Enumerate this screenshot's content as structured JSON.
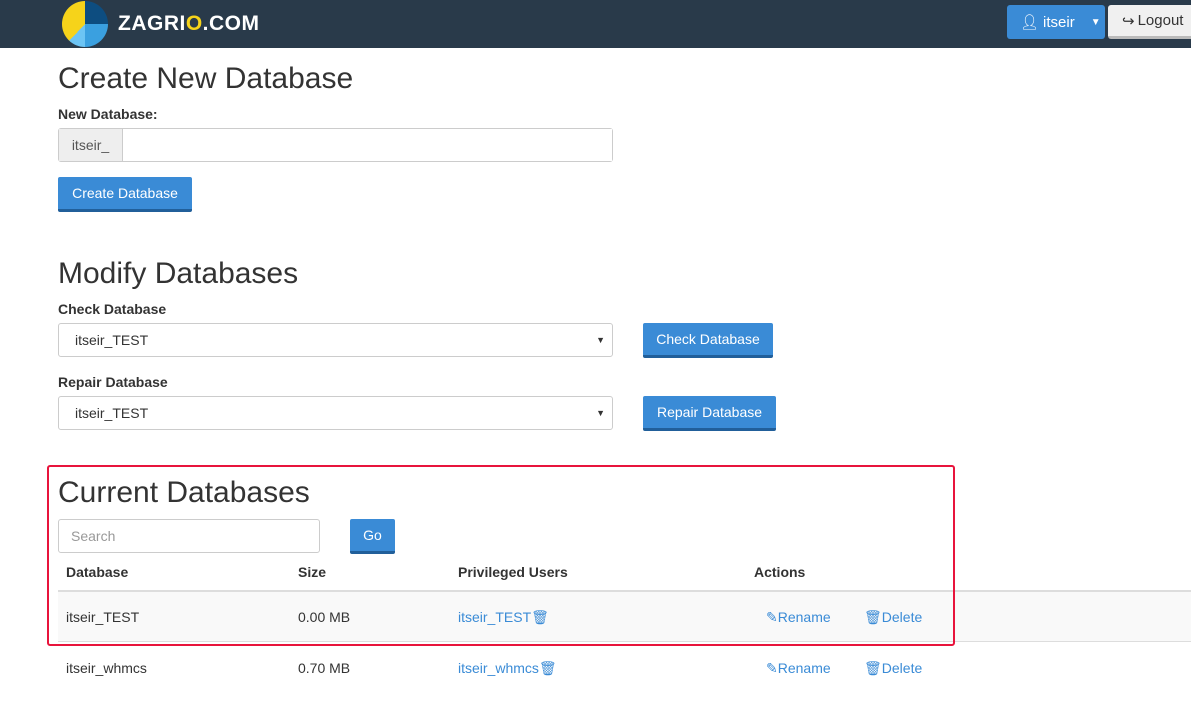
{
  "header": {
    "logo_text_a": "ZAGRI",
    "logo_text_o": "O",
    "logo_text_b": ".COM",
    "user": "itseir",
    "logout": "Logout"
  },
  "create": {
    "title": "Create New Database",
    "label": "New Database:",
    "prefix": "itseir_",
    "value": "",
    "button": "Create Database"
  },
  "modify": {
    "title": "Modify Databases",
    "check_label": "Check Database",
    "check_value": "itseir_TEST",
    "check_button": "Check Database",
    "repair_label": "Repair Database",
    "repair_value": "itseir_TEST",
    "repair_button": "Repair Database"
  },
  "current": {
    "title": "Current Databases",
    "search_placeholder": "Search",
    "go": "Go",
    "columns": [
      "Database",
      "Size",
      "Privileged Users",
      "Actions"
    ],
    "rows": [
      {
        "database": "itseir_TEST",
        "size": "0.00 MB",
        "user": "itseir_TEST",
        "rename": "Rename",
        "delete": "Delete"
      },
      {
        "database": "itseir_whmcs",
        "size": "0.70 MB",
        "user": "itseir_whmcs",
        "rename": "Rename",
        "delete": "Delete"
      }
    ]
  },
  "colors": {
    "accent": "#3a8bd6",
    "topbar": "#293a4a",
    "highlight": "#e8143c"
  }
}
